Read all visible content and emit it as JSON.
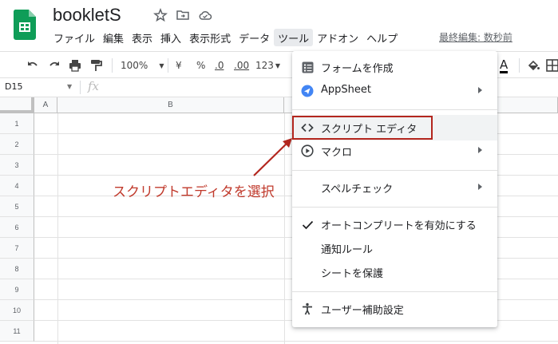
{
  "app": {
    "title": "bookletS",
    "last_edit": "最終編集: 数秒前"
  },
  "menu": [
    "ファイル",
    "編集",
    "表示",
    "挿入",
    "表示形式",
    "データ",
    "ツール",
    "アドオン",
    "ヘルプ"
  ],
  "menu_active_index": 6,
  "toolbar": {
    "zoom": "100%",
    "currency": "¥",
    "percent": "%",
    "decimal_decrease": ".0",
    "decimal_increase": ".00",
    "number_format": "123",
    "text_color_label": "A"
  },
  "formula_bar": {
    "cell_ref": "D15",
    "fx": "fx"
  },
  "grid": {
    "columns": [
      "A",
      "B"
    ],
    "rows": [
      "1",
      "2",
      "3",
      "4",
      "5",
      "6",
      "7",
      "8",
      "9",
      "10",
      "11"
    ]
  },
  "dropdown": {
    "items": [
      {
        "label": "フォームを作成",
        "icon": "form-icon",
        "submenu": false
      },
      {
        "label": "AppSheet",
        "icon": "appsheet-icon",
        "submenu": true
      },
      {
        "label": "スクリプト エディタ",
        "icon": "code-icon",
        "submenu": false,
        "highlighted": true
      },
      {
        "label": "マクロ",
        "icon": "play-circle-icon",
        "submenu": true
      },
      {
        "label": "スペルチェック",
        "icon": "",
        "submenu": true
      },
      {
        "label": "オートコンプリートを有効にする",
        "icon": "check-icon",
        "submenu": false
      },
      {
        "label": "通知ルール",
        "icon": "",
        "submenu": false
      },
      {
        "label": "シートを保護",
        "icon": "",
        "submenu": false
      },
      {
        "label": "ユーザー補助設定",
        "icon": "accessibility-icon",
        "submenu": false
      }
    ]
  },
  "annotation": {
    "text": "スクリプトエディタを選択",
    "color": "#c0392b"
  },
  "colors": {
    "sheets_green": "#0f9d58",
    "highlight_box": "#b3261e",
    "menu_active_bg": "#e8eaed"
  }
}
